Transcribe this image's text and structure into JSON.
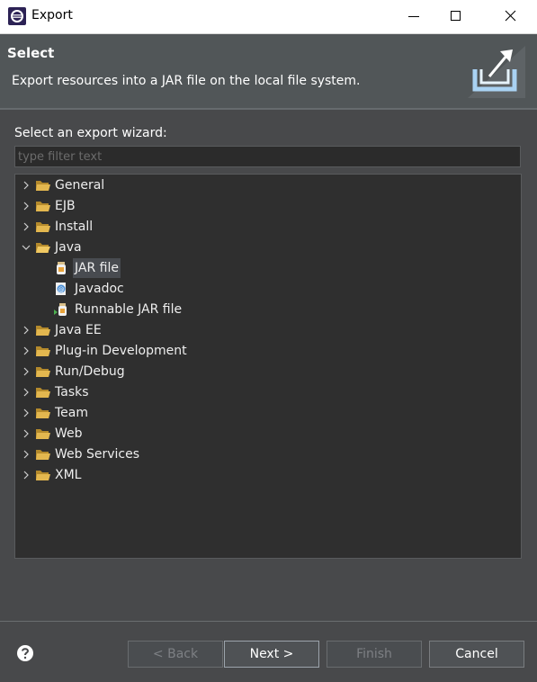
{
  "window": {
    "title": "Export"
  },
  "header": {
    "title": "Select",
    "description": "Export resources into a JAR file on the local file system."
  },
  "filter": {
    "label": "Select an export wizard:",
    "placeholder": "type filter text",
    "value": ""
  },
  "tree": {
    "items": [
      {
        "label": "General",
        "expanded": false
      },
      {
        "label": "EJB",
        "expanded": false
      },
      {
        "label": "Install",
        "expanded": false
      },
      {
        "label": "Java",
        "expanded": true,
        "children": [
          {
            "label": "JAR file",
            "icon": "jar-icon",
            "selected": true
          },
          {
            "label": "Javadoc",
            "icon": "javadoc-icon"
          },
          {
            "label": "Runnable JAR file",
            "icon": "runnable-jar-icon"
          }
        ]
      },
      {
        "label": "Java EE",
        "expanded": false
      },
      {
        "label": "Plug-in Development",
        "expanded": false
      },
      {
        "label": "Run/Debug",
        "expanded": false
      },
      {
        "label": "Tasks",
        "expanded": false
      },
      {
        "label": "Team",
        "expanded": false
      },
      {
        "label": "Web",
        "expanded": false
      },
      {
        "label": "Web Services",
        "expanded": false
      },
      {
        "label": "XML",
        "expanded": false
      }
    ]
  },
  "buttons": {
    "back": "< Back",
    "next": "Next >",
    "finish": "Finish",
    "cancel": "Cancel"
  },
  "colors": {
    "accent": "#7fb3e0",
    "folder": "#e3b74f",
    "background": "#48494b"
  }
}
